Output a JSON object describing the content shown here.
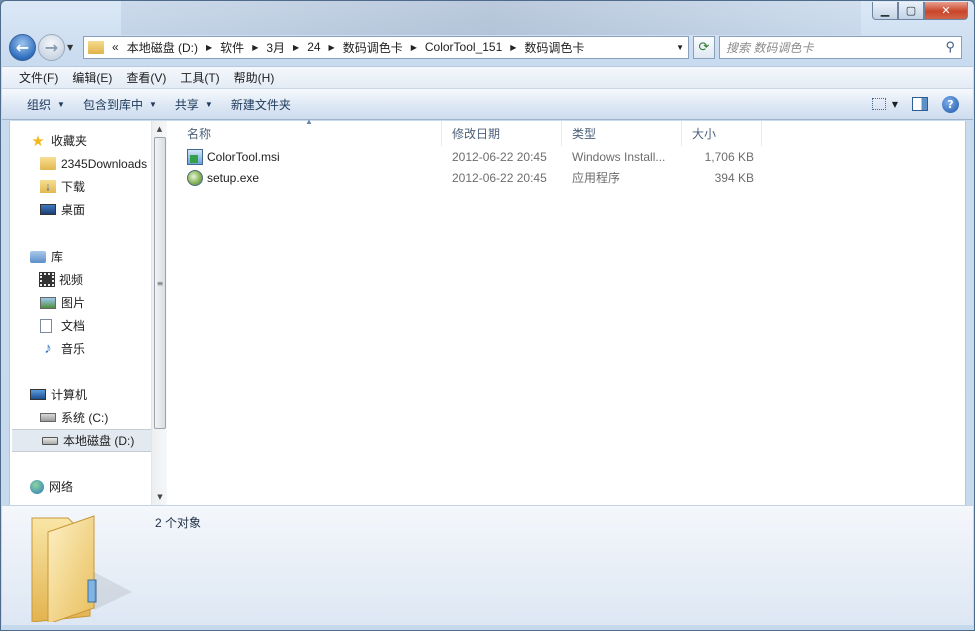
{
  "address_bar": {
    "overflow": "«",
    "crumbs": [
      "本地磁盘 (D:)",
      "软件",
      "3月",
      "24",
      "数码调色卡",
      "ColorTool_151",
      "数码调色卡"
    ]
  },
  "search": {
    "placeholder": "搜索 数码调色卡"
  },
  "menu": [
    "文件(F)",
    "编辑(E)",
    "查看(V)",
    "工具(T)",
    "帮助(H)"
  ],
  "toolbar": {
    "organize": "组织",
    "include_in_library": "包含到库中",
    "share": "共享",
    "new_folder": "新建文件夹"
  },
  "nav": {
    "favorites": {
      "label": "收藏夹",
      "items": [
        "2345Downloads",
        "下载",
        "桌面"
      ]
    },
    "libraries": {
      "label": "库",
      "items": [
        "视频",
        "图片",
        "文档",
        "音乐"
      ]
    },
    "computer": {
      "label": "计算机",
      "items": [
        "系统 (C:)",
        "本地磁盘 (D:)"
      ]
    },
    "network": {
      "label": "网络"
    }
  },
  "columns": {
    "name": "名称",
    "date": "修改日期",
    "type": "类型",
    "size": "大小"
  },
  "files": [
    {
      "name": "ColorTool.msi",
      "date": "2012-06-22 20:45",
      "type": "Windows Install...",
      "size": "1,706 KB",
      "icon": "msi-installer-icon"
    },
    {
      "name": "setup.exe",
      "date": "2012-06-22 20:45",
      "type": "应用程序",
      "size": "394 KB",
      "icon": "exe-setup-icon"
    }
  ],
  "status": {
    "count": "2 个对象"
  },
  "colors": {
    "accent": "#2f6fc0",
    "window_frame": "#c9dbef",
    "selection": "#e3e9f0"
  }
}
